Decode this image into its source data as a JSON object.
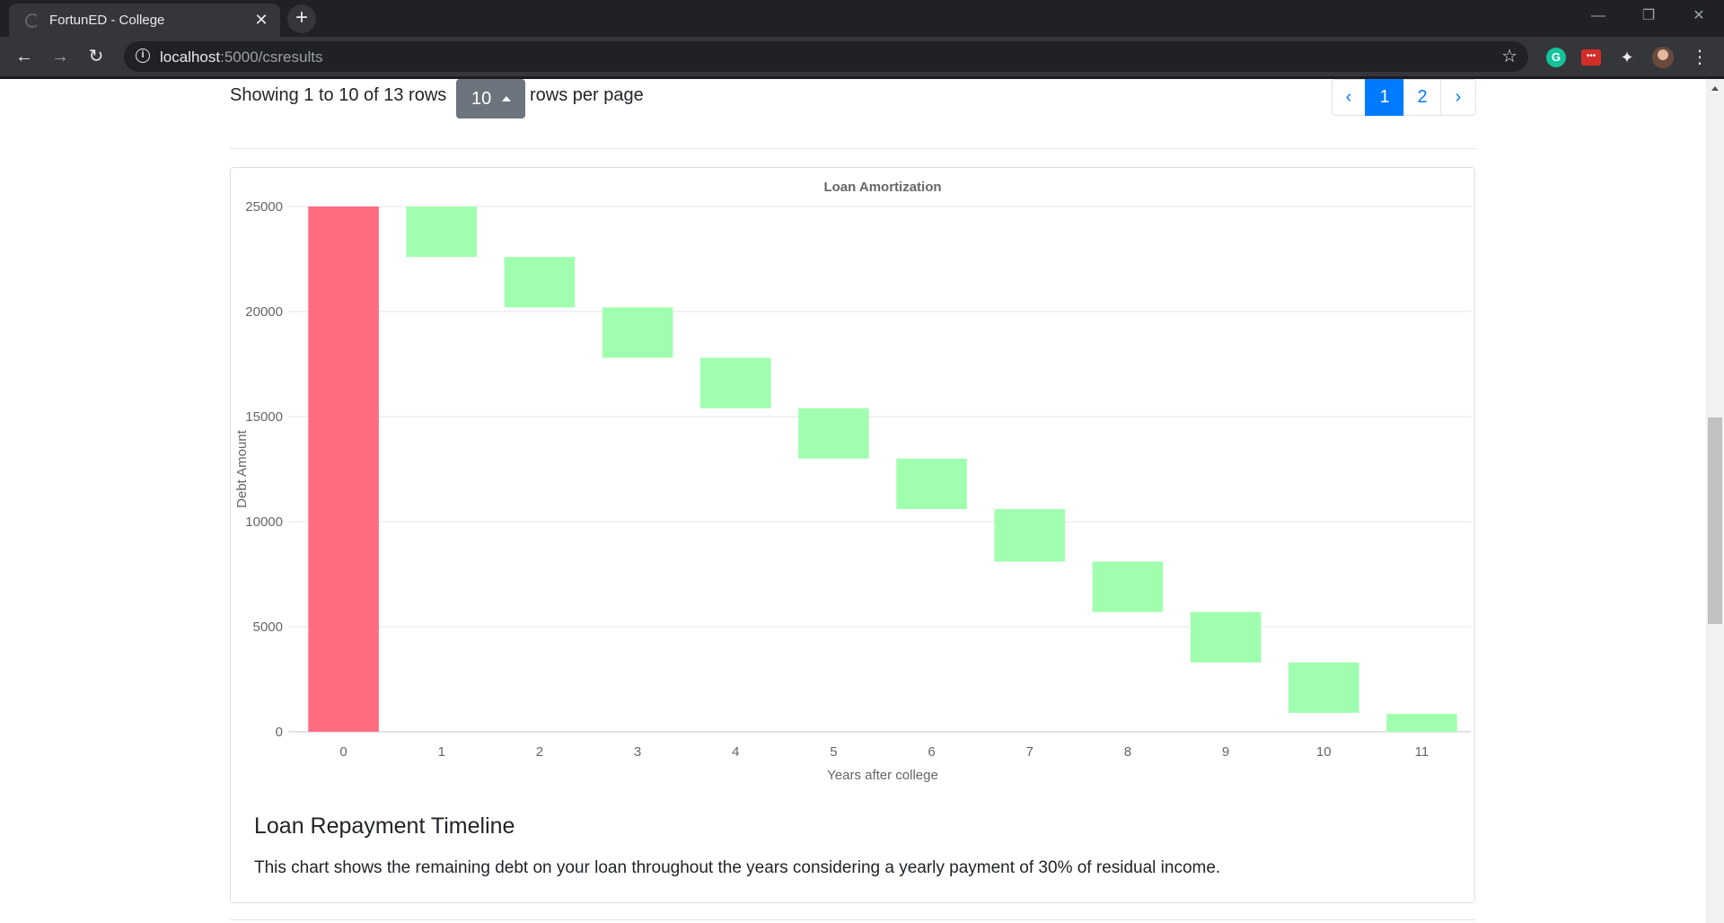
{
  "browser": {
    "tab_title": "FortunED - College",
    "url_host": "localhost",
    "url_path": ":5000/csresults",
    "grammarly_letter": "G",
    "lastpass_label": "•••"
  },
  "table_pager": {
    "showing_text": "Showing 1 to 10 of 13 rows",
    "page_size": "10",
    "per_page_text": "rows per page",
    "prev_label": "‹",
    "pages": [
      "1",
      "2"
    ],
    "active_page": "1",
    "next_label": "›"
  },
  "chart_data": {
    "type": "bar",
    "title": "Loan Amortization",
    "xlabel": "Years after college",
    "ylabel": "Debt Amount",
    "ylim": [
      0,
      25000
    ],
    "yticks": [
      0,
      5000,
      10000,
      15000,
      20000,
      25000
    ],
    "categories": [
      "0",
      "1",
      "2",
      "3",
      "4",
      "5",
      "6",
      "7",
      "8",
      "9",
      "10",
      "11"
    ],
    "ranges": [
      [
        0,
        25000
      ],
      [
        22600,
        25000
      ],
      [
        20200,
        22600
      ],
      [
        17800,
        20200
      ],
      [
        15400,
        17800
      ],
      [
        13000,
        15400
      ],
      [
        10600,
        13000
      ],
      [
        8100,
        10600
      ],
      [
        5700,
        8100
      ],
      [
        3300,
        5700
      ],
      [
        900,
        3300
      ],
      [
        0,
        850
      ]
    ],
    "colors": {
      "initial": "#ff6b81",
      "payment": "#a0ffaf"
    },
    "grid": true,
    "legend": "none"
  },
  "section": {
    "title": "Loan Repayment Timeline",
    "description": "This chart shows the remaining debt on your loan throughout the years considering a yearly payment of 30% of residual income."
  }
}
